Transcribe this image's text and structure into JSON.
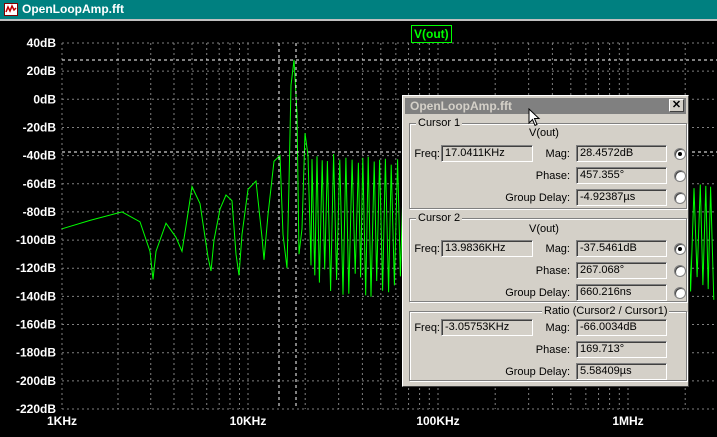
{
  "window": {
    "title": "OpenLoopAmp.fft"
  },
  "plot": {
    "trace_label": "V(out)",
    "y_ticks": [
      "40dB",
      "20dB",
      "0dB",
      "-20dB",
      "-40dB",
      "-60dB",
      "-80dB",
      "-100dB",
      "-120dB",
      "-140dB",
      "-160dB",
      "-180dB",
      "-200dB",
      "-220dB"
    ],
    "x_ticks": [
      "1KHz",
      "10KHz",
      "100KHz",
      "1MHz"
    ],
    "trace_color": "#00ff00",
    "grid_color": "#808080",
    "cursor_color": "#ffffff"
  },
  "dialog": {
    "title": "OpenLoopAmp.fft",
    "close_icon": "close-icon",
    "cursor1": {
      "group_title": "Cursor 1",
      "signal": "V(out)",
      "freq_label": "Freq:",
      "freq": "17.0411KHz",
      "mag_label": "Mag:",
      "mag": "28.4572dB",
      "phase_label": "Phase:",
      "phase": "457.355°",
      "gd_label": "Group Delay:",
      "gd": "-4.92387µs"
    },
    "cursor2": {
      "group_title": "Cursor 2",
      "signal": "V(out)",
      "freq_label": "Freq:",
      "freq": "13.9836KHz",
      "mag_label": "Mag:",
      "mag": "-37.5461dB",
      "phase_label": "Phase:",
      "phase": "267.068°",
      "gd_label": "Group Delay:",
      "gd": "660.216ns"
    },
    "ratio": {
      "group_title": "Ratio (Cursor2 / Cursor1)",
      "freq_label": "Freq:",
      "freq": "-3.05753KHz",
      "mag_label": "Mag:",
      "mag": "-66.0034dB",
      "phase_label": "Phase:",
      "phase": "169.713°",
      "gd_label": "Group Delay:",
      "gd": "5.58409µs"
    }
  }
}
